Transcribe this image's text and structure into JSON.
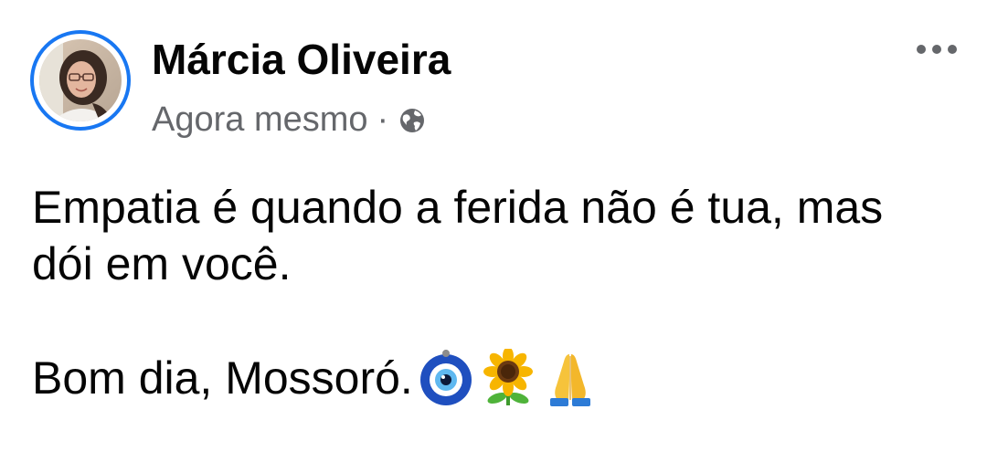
{
  "post": {
    "author_name": "Márcia Oliveira",
    "timestamp": "Agora mesmo",
    "separator": "·",
    "privacy_icon": "globe-icon",
    "more_icon": "more-options-icon",
    "text_line_1": "Empatia é quando a ferida não é tua, mas",
    "text_line_2": "dói em você.",
    "greeting": "Bom dia, Mossoró.",
    "emojis": [
      "nazar-amulet-icon",
      "sunflower-icon",
      "folded-hands-icon"
    ]
  },
  "colors": {
    "avatar_ring": "#1877f2",
    "secondary_text": "#65676b",
    "primary_text": "#050505"
  }
}
